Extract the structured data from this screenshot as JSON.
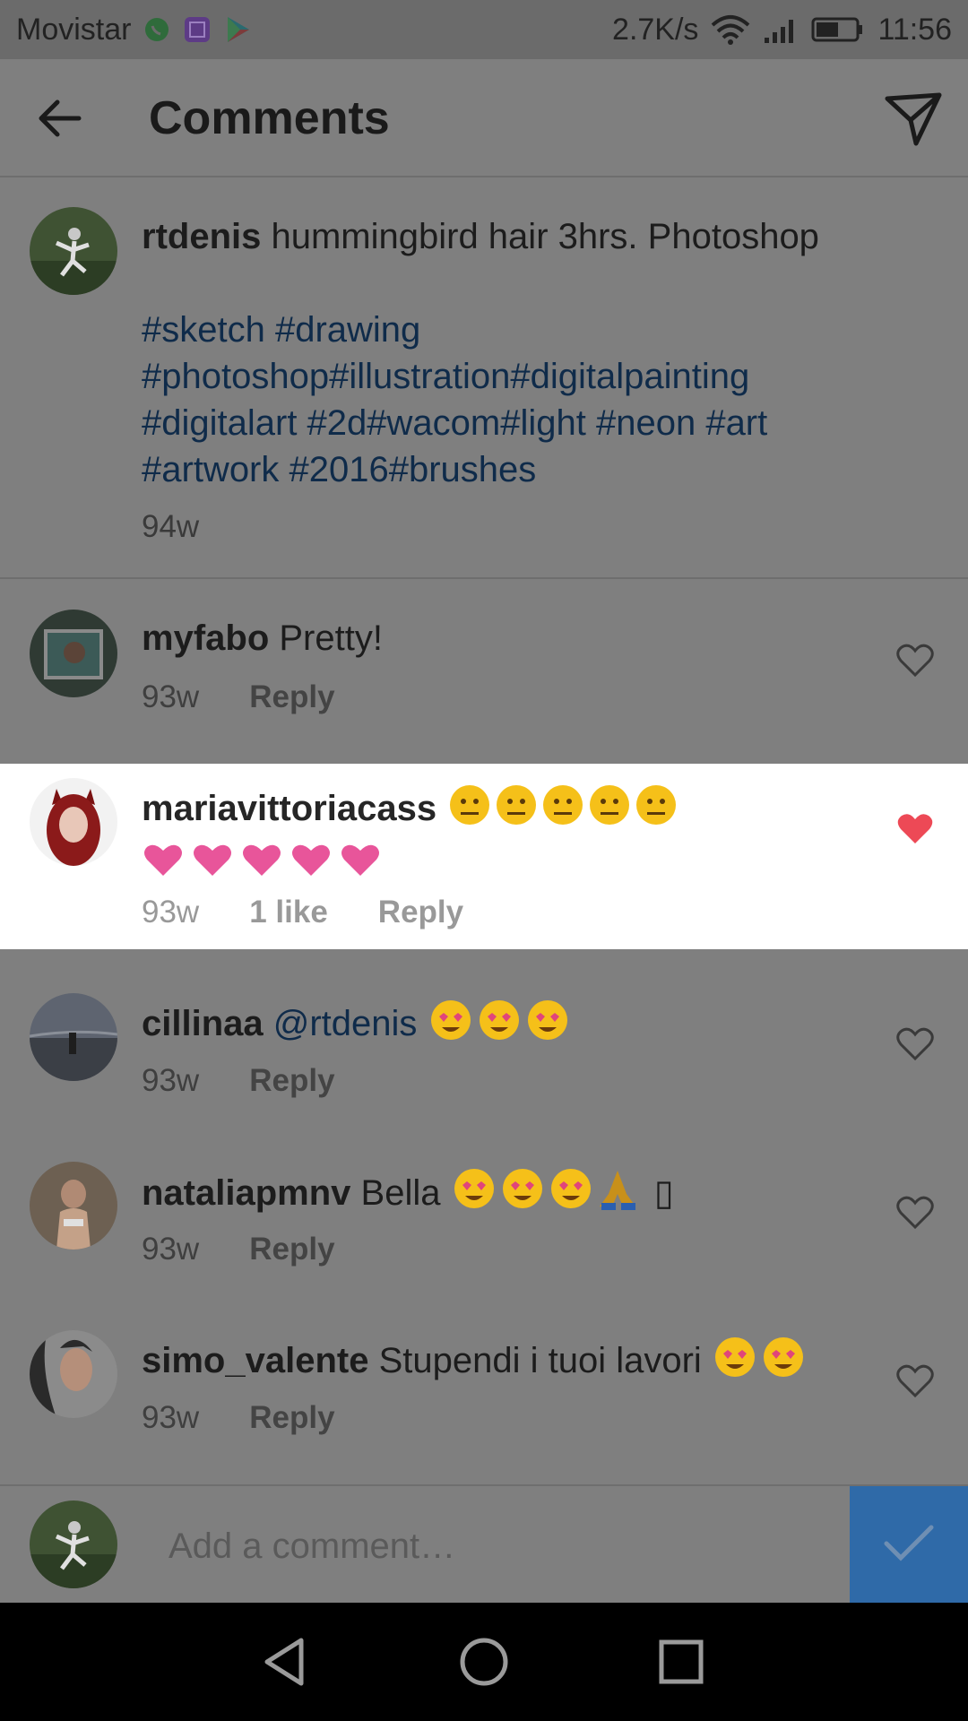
{
  "status_bar": {
    "carrier": "Movistar",
    "net_speed": "2.7K/s",
    "time": "11:56",
    "icons": [
      "whatsapp-icon",
      "gallery-icon",
      "play-store-icon",
      "wifi-icon",
      "signal-icon",
      "battery-icon"
    ]
  },
  "header": {
    "title": "Comments",
    "back_icon": "arrow-left-icon",
    "send_icon": "paper-plane-icon"
  },
  "caption": {
    "username": "rtdenis",
    "text": "hummingbird hair 3hrs. Photoshop",
    "hashtag_lines": [
      "#sketch #drawing",
      "#photoshop#illustration#digitalpainting",
      "#digitalart #2d#wacom#light #neon #art",
      "#artwork #2016#brushes"
    ],
    "age": "94w"
  },
  "comments": [
    {
      "username": "myfabo",
      "text": "Pretty!",
      "age": "93w",
      "reply": "Reply"
    },
    {
      "username": "mariavittoriacass",
      "emoji_line1": "😐😐😐😐😐",
      "emoji_line2": "❤❤❤❤❤",
      "age": "93w",
      "likes": "1 like",
      "reply": "Reply",
      "liked": true
    },
    {
      "username": "cillinaa",
      "mention": "@rtdenis",
      "emoji": "😍😍😍",
      "age": "93w",
      "reply": "Reply"
    },
    {
      "username": "nataliapmnv",
      "text": "Bella",
      "emoji": "😍😍😍🙏",
      "tofu": "▯",
      "age": "93w",
      "reply": "Reply"
    },
    {
      "username": "simo_valente",
      "text": "Stupendi i tuoi lavori",
      "emoji": "😍😍",
      "age": "93w",
      "reply": "Reply"
    }
  ],
  "composer": {
    "placeholder": "Add a comment…",
    "post_icon": "checkmark-icon"
  },
  "colors": {
    "overlay": "#7f7f7f",
    "accent": "#2f6aa8",
    "liked_heart": "#ed4956",
    "pink_heart": "#e8559a",
    "emoji_yellow": "#f5c019"
  }
}
